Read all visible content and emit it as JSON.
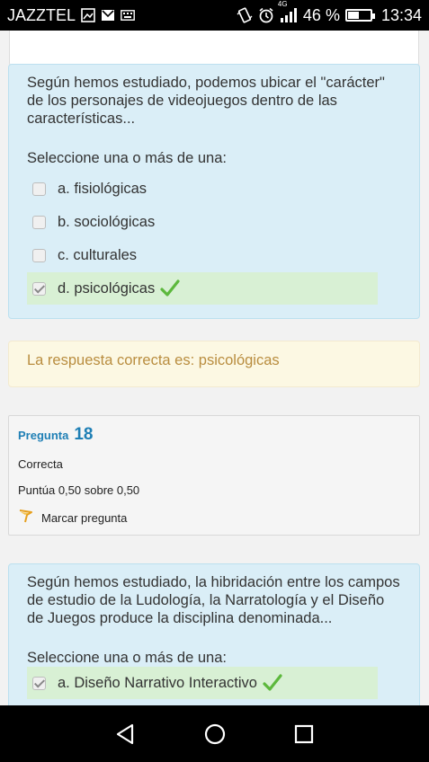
{
  "status_bar": {
    "carrier": "JAZZTEL",
    "network": "4G",
    "battery_percent": "46 %",
    "battery_level": 0.46,
    "time": "13:34",
    "icons": [
      "image-icon",
      "gmail-icon",
      "keyboard-icon",
      "vibrate-icon",
      "alarm-icon",
      "signal-icon",
      "battery-icon"
    ]
  },
  "question1": {
    "text": "Según hemos estudiado, podemos ubicar el \"carácter\" de los personajes de videojuegos dentro de las características...",
    "prompt": "Seleccione una o más de una:",
    "options": [
      {
        "label": "a. fisiológicas",
        "checked": false,
        "correct": false
      },
      {
        "label": "b. sociológicas",
        "checked": false,
        "correct": false
      },
      {
        "label": "c. culturales",
        "checked": false,
        "correct": false
      },
      {
        "label": "d. psicológicas",
        "checked": true,
        "correct": true
      }
    ]
  },
  "feedback1": {
    "text": "La respuesta correcta es: psicológicas"
  },
  "question2_info": {
    "label": "Pregunta",
    "number": "18",
    "state": "Correcta",
    "grade": "Puntúa 0,50 sobre 0,50",
    "flag_label": "Marcar pregunta"
  },
  "question2": {
    "text": "Según hemos estudiado, la hibridación entre los campos de estudio de la Ludología, la Narratología y el Diseño de Juegos produce la disciplina denominada...",
    "prompt": "Seleccione una o más de una:",
    "options": [
      {
        "label": "a. Diseño Narrativo Interactivo",
        "checked": true,
        "correct": true
      }
    ]
  },
  "colors": {
    "question_bg": "#daeef7",
    "correct_bg": "#d8f0d4",
    "feedback_text": "#b98d3f",
    "question_number": "#1e7fb5",
    "tick": "#5cb83c"
  }
}
